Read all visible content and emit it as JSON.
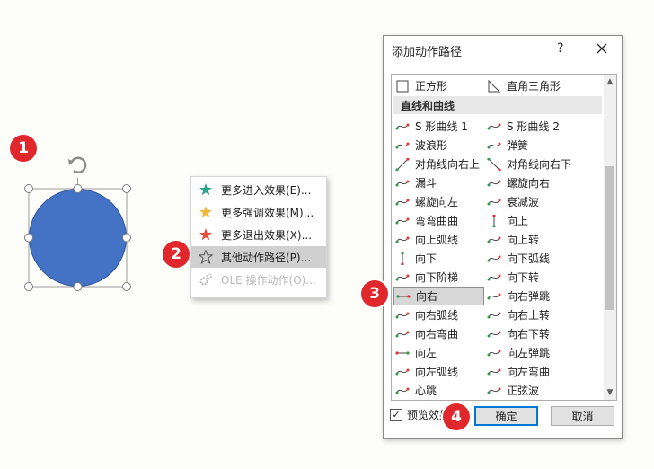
{
  "badges": [
    "1",
    "2",
    "3",
    "4"
  ],
  "context_menu": {
    "items": [
      {
        "label": "更多进入效果(E)...",
        "icon": "green-star-icon",
        "color": "#2aa189"
      },
      {
        "label": "更多强调效果(M)...",
        "icon": "yellow-star-icon",
        "color": "#f2b63a"
      },
      {
        "label": "更多退出效果(X)...",
        "icon": "red-star-icon",
        "color": "#e2523a"
      },
      {
        "label": "其他动作路径(P)...",
        "icon": "outline-star-icon",
        "color": "#555555"
      },
      {
        "label": "OLE 操作动作(O)...",
        "icon": "gears-icon",
        "color": "#b8b8b8"
      }
    ]
  },
  "dialog": {
    "title": "添加动作路径",
    "help": "?",
    "group_header": "直线和曲线",
    "top_row": [
      {
        "label": "正方形",
        "icon": "square-path-icon"
      },
      {
        "label": "直角三角形",
        "icon": "right-triangle-path-icon"
      }
    ],
    "left_items": [
      {
        "label": "S 形曲线 1",
        "icon": "s-curve-icon"
      },
      {
        "label": "波浪形",
        "icon": "wave-icon"
      },
      {
        "label": "对角线向右上",
        "icon": "diagonal-up-right-icon"
      },
      {
        "label": "漏斗",
        "icon": "funnel-icon"
      },
      {
        "label": "螺旋向左",
        "icon": "spiral-left-icon"
      },
      {
        "label": "弯弯曲曲",
        "icon": "zigzag-icon"
      },
      {
        "label": "向上弧线",
        "icon": "arc-up-icon"
      },
      {
        "label": "向下",
        "icon": "down-path-icon"
      },
      {
        "label": "向下阶梯",
        "icon": "stairs-down-icon"
      },
      {
        "label": "向右",
        "icon": "right-path-icon"
      },
      {
        "label": "向右弧线",
        "icon": "arc-right-icon"
      },
      {
        "label": "向右弯曲",
        "icon": "curvy-right-icon"
      },
      {
        "label": "向左",
        "icon": "left-path-icon"
      },
      {
        "label": "向左弧线",
        "icon": "arc-left-icon"
      },
      {
        "label": "心跳",
        "icon": "heartbeat-icon"
      }
    ],
    "right_items": [
      {
        "label": "S 形曲线 2",
        "icon": "s-curve-2-icon"
      },
      {
        "label": "弹簧",
        "icon": "spring-icon"
      },
      {
        "label": "对角线向右下",
        "icon": "diagonal-down-right-icon"
      },
      {
        "label": "螺旋向右",
        "icon": "spiral-right-icon"
      },
      {
        "label": "衰减波",
        "icon": "decaying-wave-icon"
      },
      {
        "label": "向上",
        "icon": "up-path-icon"
      },
      {
        "label": "向上转",
        "icon": "turn-up-icon"
      },
      {
        "label": "向下弧线",
        "icon": "arc-down-icon"
      },
      {
        "label": "向下转",
        "icon": "turn-down-icon"
      },
      {
        "label": "向右弹跳",
        "icon": "bounce-right-icon"
      },
      {
        "label": "向右上转",
        "icon": "turn-up-right-icon"
      },
      {
        "label": "向右下转",
        "icon": "turn-down-right-icon"
      },
      {
        "label": "向左弹跳",
        "icon": "bounce-left-icon"
      },
      {
        "label": "向左弯曲",
        "icon": "curvy-left-icon"
      },
      {
        "label": "正弦波",
        "icon": "sine-wave-icon"
      }
    ],
    "selected": "向右",
    "preview_label": "预览效果",
    "preview_checked": true,
    "ok_label": "确定",
    "cancel_label": "取消"
  },
  "colors": {
    "shape_fill": "#4472c4",
    "badge": "#e0282c",
    "path_green": "#2e9a4a",
    "path_red": "#d33"
  }
}
